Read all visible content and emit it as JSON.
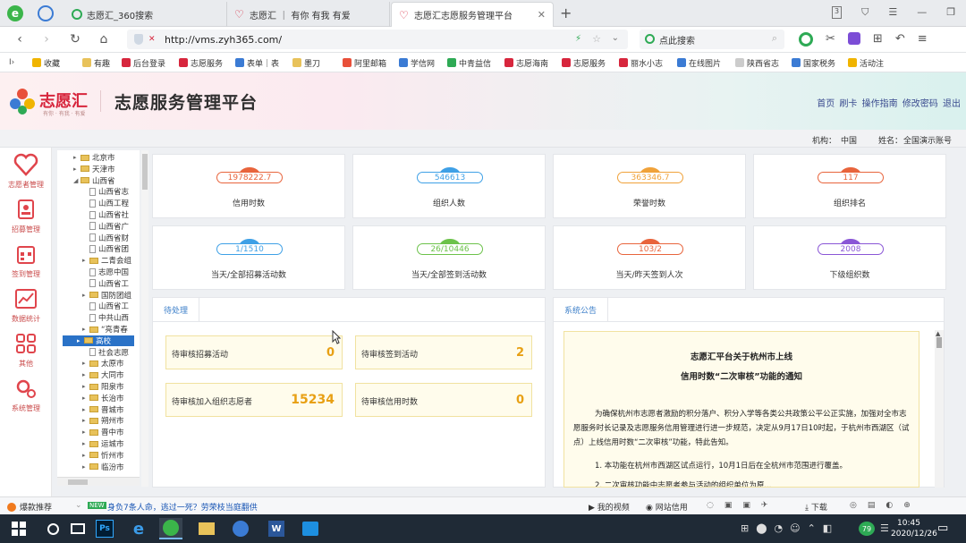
{
  "browser": {
    "tabs": [
      {
        "title": "志愿汇_360搜索"
      },
      {
        "title": "志愿汇 ｜ 有你 有我 有爱"
      },
      {
        "title": "志愿汇志愿服务管理平台"
      }
    ],
    "url": "http://vms.zyh365.com/",
    "search_placeholder": "点此搜索",
    "bookmarks": [
      "收藏",
      "有趣",
      "后台登录",
      "志愿服务",
      "表单｜表",
      "墨刀",
      "阿里邮箱",
      "学信网",
      "中青益信",
      "志愿海南",
      "志愿服务",
      "丽水小志",
      "在线图片",
      "陕西省志",
      "国家税务",
      "活动注"
    ]
  },
  "header": {
    "logo_text": "志愿汇",
    "logo_sub": "有你 · 有我 · 有爱",
    "title": "志愿服务管理平台",
    "links": [
      "首页",
      "刷卡",
      "操作指南",
      "修改密码",
      "退出"
    ]
  },
  "userbar": {
    "org_label": "机构：",
    "org_value": "中国",
    "name_label": "姓名：",
    "name_value": "全国演示账号"
  },
  "leftnav": [
    "志愿者管理",
    "招募管理",
    "签到管理",
    "数据统计",
    "其他",
    "系统管理"
  ],
  "tree": [
    {
      "label": "北京市",
      "type": "folder",
      "indent": 0,
      "arrow": "▸"
    },
    {
      "label": "天津市",
      "type": "folder",
      "indent": 0,
      "arrow": "▸"
    },
    {
      "label": "山西省",
      "type": "folder",
      "indent": 0,
      "arrow": "◢"
    },
    {
      "label": "山西省志",
      "type": "doc",
      "indent": 1,
      "arrow": ""
    },
    {
      "label": "山西工程",
      "type": "doc",
      "indent": 1,
      "arrow": ""
    },
    {
      "label": "山西省社",
      "type": "doc",
      "indent": 1,
      "arrow": ""
    },
    {
      "label": "山西省广",
      "type": "doc",
      "indent": 1,
      "arrow": ""
    },
    {
      "label": "山西省财",
      "type": "doc",
      "indent": 1,
      "arrow": ""
    },
    {
      "label": "山西省团",
      "type": "doc",
      "indent": 1,
      "arrow": ""
    },
    {
      "label": "二青会组",
      "type": "folder",
      "indent": 1,
      "arrow": "▸"
    },
    {
      "label": "志愿中国",
      "type": "doc",
      "indent": 1,
      "arrow": ""
    },
    {
      "label": "山西省工",
      "type": "doc",
      "indent": 1,
      "arrow": ""
    },
    {
      "label": "国防团组",
      "type": "folder",
      "indent": 1,
      "arrow": "▸"
    },
    {
      "label": "山西省工",
      "type": "doc",
      "indent": 1,
      "arrow": ""
    },
    {
      "label": "中共山西",
      "type": "doc",
      "indent": 1,
      "arrow": ""
    },
    {
      "label": "“亮青春",
      "type": "folder",
      "indent": 1,
      "arrow": "▸"
    },
    {
      "label": "高校",
      "type": "folder",
      "indent": 1,
      "arrow": "▸",
      "selected": true
    },
    {
      "label": "社会志愿",
      "type": "doc",
      "indent": 1,
      "arrow": ""
    },
    {
      "label": "太原市",
      "type": "folder",
      "indent": 1,
      "arrow": "▸"
    },
    {
      "label": "大同市",
      "type": "folder",
      "indent": 1,
      "arrow": "▸"
    },
    {
      "label": "阳泉市",
      "type": "folder",
      "indent": 1,
      "arrow": "▸"
    },
    {
      "label": "长治市",
      "type": "folder",
      "indent": 1,
      "arrow": "▸"
    },
    {
      "label": "晋城市",
      "type": "folder",
      "indent": 1,
      "arrow": "▸"
    },
    {
      "label": "朔州市",
      "type": "folder",
      "indent": 1,
      "arrow": "▸"
    },
    {
      "label": "晋中市",
      "type": "folder",
      "indent": 1,
      "arrow": "▸"
    },
    {
      "label": "运城市",
      "type": "folder",
      "indent": 1,
      "arrow": "▸"
    },
    {
      "label": "忻州市",
      "type": "folder",
      "indent": 1,
      "arrow": "▸"
    },
    {
      "label": "临汾市",
      "type": "folder",
      "indent": 1,
      "arrow": "▸"
    }
  ],
  "stats": [
    {
      "value": "1978222.7",
      "label": "信用时数",
      "color": "#e8643c"
    },
    {
      "value": "546613",
      "label": "组织人数",
      "color": "#3ea0e6"
    },
    {
      "value": "363346.7",
      "label": "荣誉时数",
      "color": "#f0a23a"
    },
    {
      "value": "117",
      "label": "组织排名",
      "color": "#e8643c"
    },
    {
      "value": "1/1510",
      "label": "当天/全部招募活动数",
      "color": "#3ea0e6"
    },
    {
      "value": "26/10446",
      "label": "当天/全部签到活动数",
      "color": "#6cc24a"
    },
    {
      "value": "103/2",
      "label": "当天/昨天签到人次",
      "color": "#e8643c"
    },
    {
      "value": "2008",
      "label": "下级组织数",
      "color": "#8a56d6"
    }
  ],
  "pending": {
    "tab": "待处理",
    "items": [
      {
        "label": "待审核招募活动",
        "value": "0"
      },
      {
        "label": "待审核签到活动",
        "value": "2"
      },
      {
        "label": "待审核加入组织志愿者",
        "value": "15234"
      },
      {
        "label": "待审核信用时数",
        "value": "0"
      }
    ]
  },
  "announcement": {
    "tab": "系统公告",
    "title_line1": "志愿汇平台关于杭州市上线",
    "title_line2": "信用时数“二次审核”功能的通知",
    "body": "为确保杭州市志愿者激励的积分落户、积分入学等各类公共政策公平公正实施，加强对全市志愿服务时长记录及志愿服务信用管理进行进一步规范，决定从9月17日10时起，于杭州市西湖区（试点）上线信用时数“二次审核”功能，特此告知。",
    "item1": "1. 本功能在杭州市西湖区试点运行，10月1日后在全杭州市范围进行覆盖。",
    "item2": "2. 二次审核功能中志愿者参与活动的组织单位为原..."
  },
  "statusbar": {
    "left": "爆款推荐",
    "news": "身负7条人命，逃过一死？劳荣枝当庭翻供",
    "video": "我的视频",
    "cards": "网站信用",
    "download": "下载"
  },
  "taskbar": {
    "time": "10:45",
    "date": "2020/12/26",
    "badge": "79"
  }
}
